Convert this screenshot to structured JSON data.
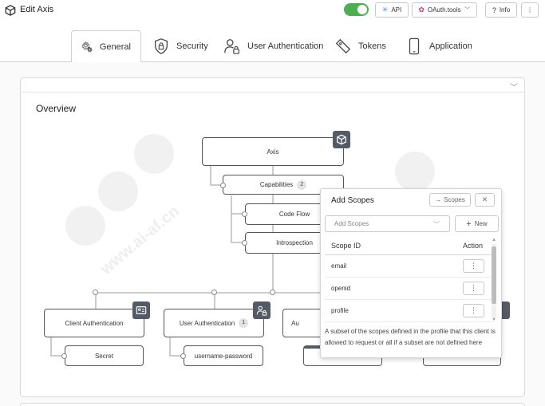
{
  "header": {
    "title": "Edit Axis",
    "app_icon": "cube-icon",
    "toggle_on": true,
    "api_label": "API",
    "oauth_label": "OAuth.tools",
    "info_label": "Info",
    "more_label": "⋮"
  },
  "tabs": [
    {
      "label": "General",
      "icon": "gear-icon",
      "active": true
    },
    {
      "label": "Security",
      "icon": "shield-icon",
      "active": false
    },
    {
      "label": "User Authentication",
      "icon": "user-lock-icon",
      "active": false
    },
    {
      "label": "Tokens",
      "icon": "ticket-icon",
      "active": false
    },
    {
      "label": "Application",
      "icon": "phone-icon",
      "active": false
    }
  ],
  "overview": {
    "title": "Overview"
  },
  "diagram": {
    "root": {
      "label": "Axis",
      "icon": "cube-icon"
    },
    "capabilities": {
      "label": "Capabilities",
      "count": "2"
    },
    "code_flow": {
      "label": "Code Flow"
    },
    "introspection": {
      "label": "Introspection"
    },
    "client_auth": {
      "label": "Client Authentication",
      "icon": "id-card-icon"
    },
    "secret": {
      "label": "Secret"
    },
    "user_auth": {
      "label": "User Authentication",
      "count": "1",
      "icon": "user-lock-icon"
    },
    "username_password": {
      "label": "username-password"
    },
    "partial_label": "Au"
  },
  "popup": {
    "title": "Add Scopes",
    "scopes_button": "Scopes",
    "close_button": "✕",
    "select_placeholder": "Add Scopes",
    "new_button": "New",
    "col_scope_id": "Scope ID",
    "col_action": "Action",
    "rows": [
      {
        "scope_id": "email"
      },
      {
        "scope_id": "openid"
      },
      {
        "scope_id": "profile"
      }
    ],
    "row_action": "⋮",
    "description": "A subset of the scopes defined in the profile that this client is allowed to request or all if a subset are not defined here"
  },
  "colors": {
    "toggle": "#4caf50",
    "api_icon": "#4a8fd8",
    "oauth_icon": "#d2387e",
    "node_icon_bg": "#555b66"
  }
}
